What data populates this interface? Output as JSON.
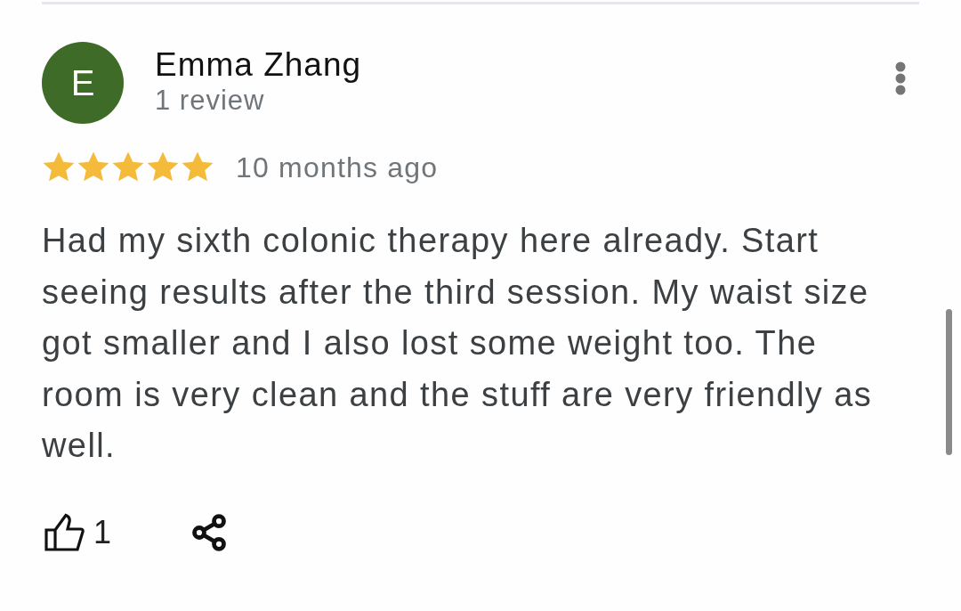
{
  "review": {
    "reviewer": {
      "avatar_letter": "E",
      "name": "Emma Zhang",
      "review_count": "1 review"
    },
    "rating": {
      "stars": 5,
      "time": "10 months ago"
    },
    "text": "Had my sixth colonic therapy here already. Start seeing results after the third session. My waist size got smaller and I also lost some weight too. The room is very clean and the stuff are very friendly as well.",
    "actions": {
      "likes": "1"
    }
  }
}
